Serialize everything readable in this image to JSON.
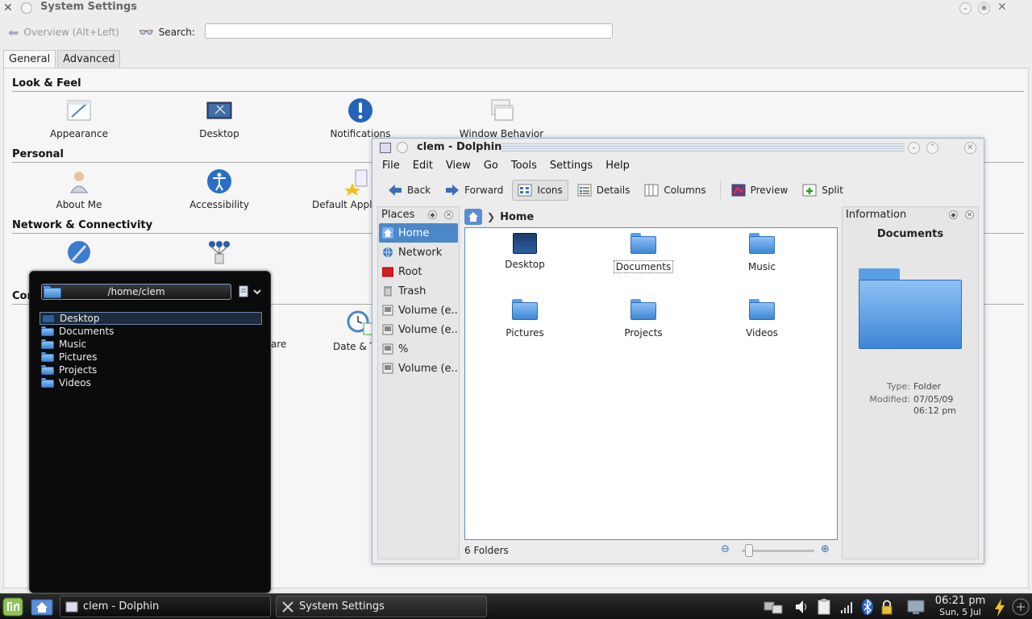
{
  "system_settings": {
    "title": "System Settings",
    "overview_label": "Overview (Alt+Left)",
    "search_label": "Search:",
    "search_value": "",
    "tabs": [
      "General",
      "Advanced"
    ],
    "sections": {
      "look_feel": {
        "heading": "Look & Feel",
        "items": [
          "Appearance",
          "Desktop",
          "Notifications",
          "Window Behavior"
        ]
      },
      "personal": {
        "heading": "Personal",
        "items": [
          "About Me",
          "Accessibility",
          "Default Appl"
        ]
      },
      "network": {
        "heading": "Network & Connectivity"
      },
      "computer": {
        "heading_fragment": "Con",
        "items": [
          "are",
          "Date & T"
        ]
      }
    }
  },
  "dolphin": {
    "title": "clem - Dolphin",
    "menu": [
      "File",
      "Edit",
      "View",
      "Go",
      "Tools",
      "Settings",
      "Help"
    ],
    "toolbar": {
      "back": "Back",
      "forward": "Forward",
      "icons": "Icons",
      "details": "Details",
      "columns": "Columns",
      "preview": "Preview",
      "split": "Split"
    },
    "places": {
      "title": "Places",
      "items": [
        "Home",
        "Network",
        "Root",
        "Trash",
        "Volume (e...",
        "Volume (e...",
        "%",
        "Volume (e..."
      ]
    },
    "breadcrumb": {
      "current": "Home"
    },
    "files": [
      "Desktop",
      "Documents",
      "Music",
      "Pictures",
      "Projects",
      "Videos"
    ],
    "status": "6 Folders",
    "zoom_level": 0.05,
    "information": {
      "title": "Information",
      "name": "Documents",
      "type_label": "Type:",
      "type_value": "Folder",
      "modified_label": "Modified:",
      "modified_date": "07/05/09",
      "modified_time": "06:12 pm"
    }
  },
  "folder_view": {
    "path": "/home/clem",
    "items": [
      "Desktop",
      "Documents",
      "Music",
      "Pictures",
      "Projects",
      "Videos"
    ]
  },
  "taskbar": {
    "tasks": [
      "clem - Dolphin",
      "System Settings"
    ],
    "clock_time": "06:21 pm",
    "clock_date": "Sun, 5 Jul"
  },
  "colors": {
    "selection": "#4c87c8",
    "panel": "#111111",
    "folder": "#5a9ee8"
  }
}
